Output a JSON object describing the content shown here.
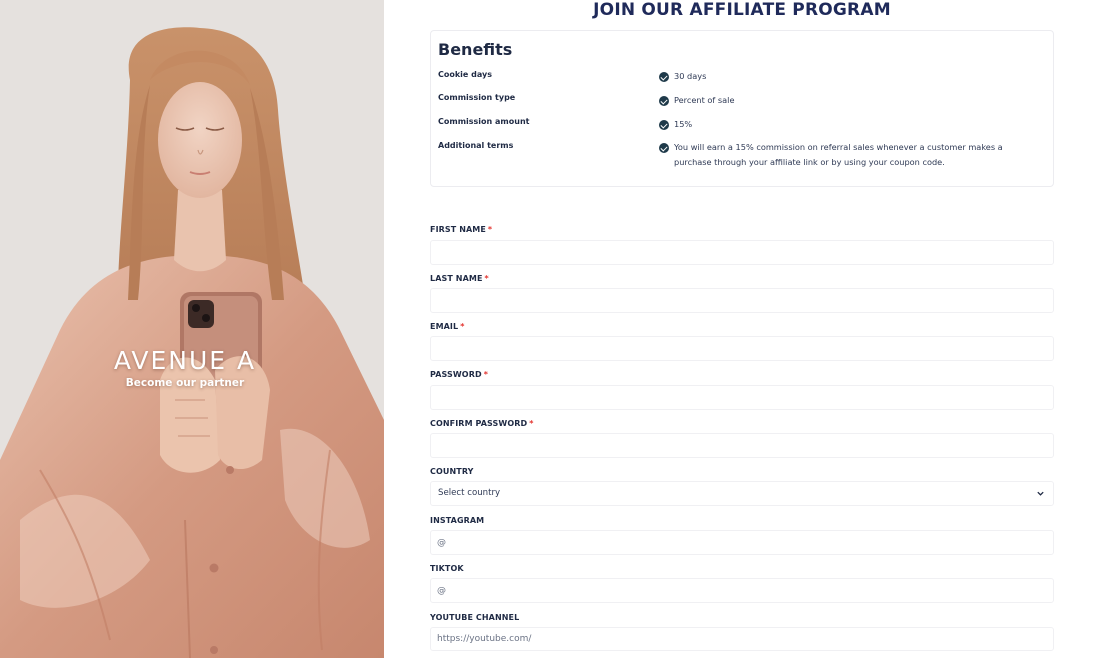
{
  "hero": {
    "brand_name": "AVENUE A",
    "brand_tagline": "Become our partner"
  },
  "page": {
    "title": "JOIN OUR AFFILIATE PROGRAM"
  },
  "benefits": {
    "title": "Benefits",
    "rows": [
      {
        "label": "Cookie days",
        "value": "30 days"
      },
      {
        "label": "Commission type",
        "value": "Percent of sale"
      },
      {
        "label": "Commission amount",
        "value": "15%"
      },
      {
        "label": "Additional terms",
        "value": "You will earn a 15% commission on referral sales whenever a customer makes a purchase through your affiliate link or by using your coupon code."
      }
    ],
    "check_icon": "check-circle-icon"
  },
  "form": {
    "required_mark": "*",
    "first_name": {
      "label": "FIRST NAME",
      "value": "",
      "placeholder": ""
    },
    "last_name": {
      "label": "LAST NAME",
      "value": "",
      "placeholder": ""
    },
    "email": {
      "label": "EMAIL",
      "value": "",
      "placeholder": ""
    },
    "password": {
      "label": "PASSWORD",
      "value": "",
      "placeholder": ""
    },
    "confirm_password": {
      "label": "CONFIRM PASSWORD",
      "value": "",
      "placeholder": ""
    },
    "country": {
      "label": "COUNTRY",
      "selected": "Select country",
      "icon": "chevron-down-icon"
    },
    "instagram": {
      "label": "INSTAGRAM",
      "value": "",
      "placeholder": "@"
    },
    "tiktok": {
      "label": "TIKTOK",
      "value": "",
      "placeholder": "@"
    },
    "youtube": {
      "label": "YOUTUBE CHANNEL",
      "value": "",
      "placeholder": "https://youtube.com/"
    }
  },
  "colors": {
    "title": "#1f2a5a",
    "required": "#e3342f",
    "check": "#1f3a4a",
    "satin": "#d9a48e"
  }
}
